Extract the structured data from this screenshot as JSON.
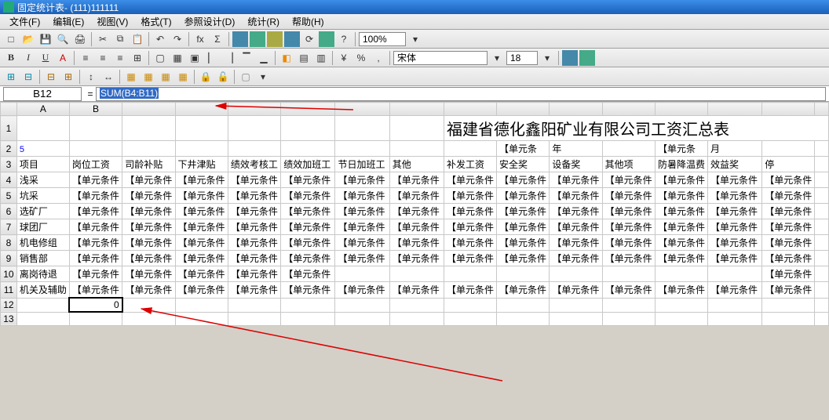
{
  "window": {
    "title": "固定统计表- (111)111111"
  },
  "menu": {
    "items": [
      "文件(F)",
      "编辑(E)",
      "视图(V)",
      "格式(T)",
      "参照设计(D)",
      "统计(R)",
      "帮助(H)"
    ]
  },
  "toolbar1": {
    "new": "□",
    "open": "📂",
    "save": "💾",
    "cut": "✂",
    "copy": "⧉",
    "paste": "📋",
    "undo": "↶",
    "redo": "↷",
    "fx": "fx",
    "sigma": "Σ",
    "zoom_value": "100%"
  },
  "toolbar2": {
    "bold": "B",
    "italic": "I",
    "underline": "U",
    "fontcolor": "A",
    "percent": "%",
    "comma": ",",
    "font_name": "宋体",
    "font_size": "18"
  },
  "formulabar": {
    "cell_ref": "B12",
    "eq": "=",
    "formula_prefix": "",
    "formula": "SUM(B4:B11)"
  },
  "chart_data": {
    "type": "table",
    "title": "福建省德化鑫阳矿业有限公司工资汇总表",
    "col_letters": [
      "A",
      "B"
    ],
    "row_numbers": [
      "1",
      "2",
      "3",
      "4",
      "5",
      "6",
      "7",
      "8",
      "9",
      "10",
      "11",
      "12",
      "13"
    ],
    "row2": {
      "colK_prefix": "【单元条",
      "colK_suffix": "年",
      "colM_prefix": "【单元条",
      "colM_suffix": "月"
    },
    "headers": [
      "项目",
      "岗位工资",
      "司龄补贴",
      "下井津贴",
      "绩效考核工",
      "绩效加班工",
      "节日加班工",
      "其他",
      "补发工资",
      "安全奖",
      "设备奖",
      "其他项",
      "防暑降温费",
      "效益奖",
      "停"
    ],
    "row_labels": [
      "浅采",
      "坑采",
      "选矿厂",
      "球团厂",
      "机电修组",
      "销售部",
      "离岗待退",
      "机关及辅助"
    ],
    "cell_token": "【单元条件",
    "filled_cells": {
      "r4": [
        1,
        1,
        1,
        1,
        1,
        1,
        1,
        1,
        1,
        1,
        1,
        1,
        1,
        1
      ],
      "r5": [
        1,
        1,
        1,
        1,
        1,
        1,
        1,
        1,
        1,
        1,
        1,
        1,
        1,
        1
      ],
      "r6": [
        1,
        1,
        1,
        1,
        1,
        1,
        1,
        1,
        1,
        1,
        1,
        1,
        1,
        1
      ],
      "r7": [
        1,
        1,
        1,
        1,
        1,
        1,
        1,
        1,
        1,
        1,
        1,
        1,
        1,
        1
      ],
      "r8": [
        1,
        1,
        1,
        1,
        1,
        1,
        1,
        1,
        1,
        1,
        1,
        1,
        1,
        1
      ],
      "r9": [
        1,
        1,
        1,
        1,
        1,
        1,
        1,
        1,
        1,
        1,
        1,
        1,
        1,
        1
      ],
      "r10": [
        1,
        1,
        1,
        1,
        1,
        0,
        0,
        0,
        0,
        0,
        0,
        0,
        0,
        1
      ],
      "r11": [
        1,
        1,
        1,
        1,
        1,
        1,
        1,
        1,
        1,
        1,
        1,
        1,
        1,
        1
      ]
    },
    "b12_value": "0",
    "row2_a_blue": "5"
  }
}
